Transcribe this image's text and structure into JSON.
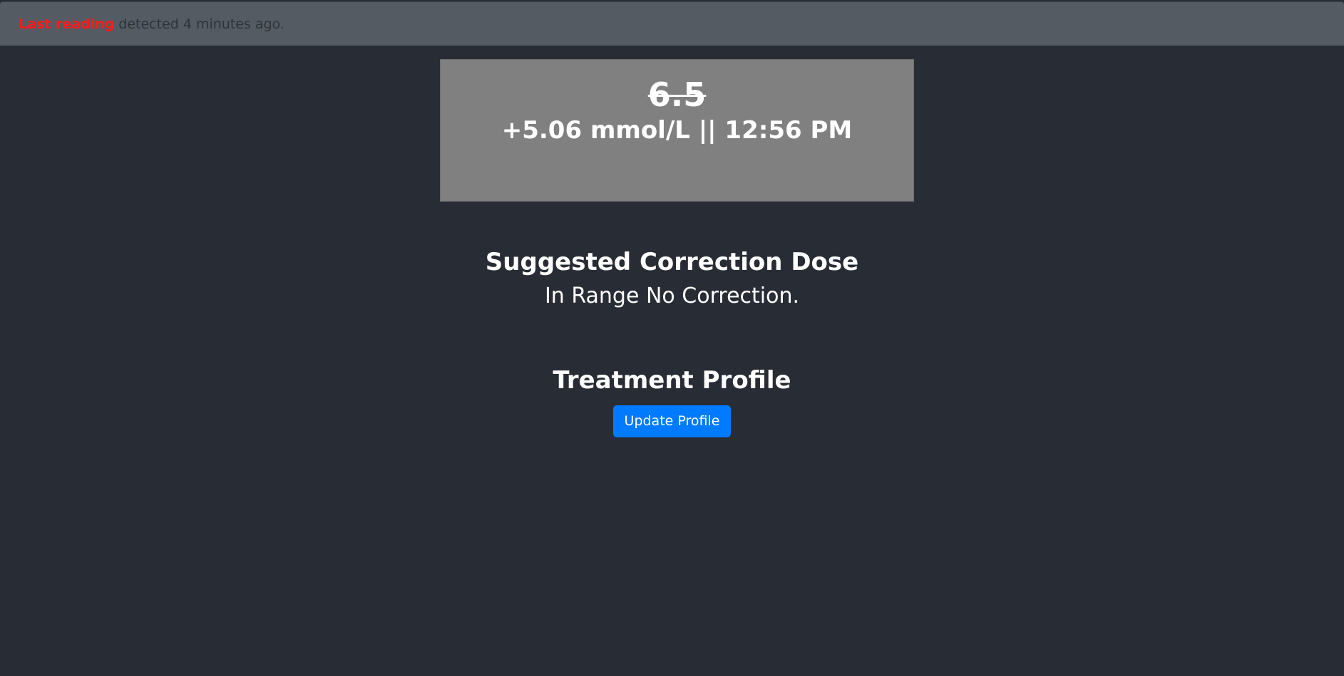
{
  "alert": {
    "strong_text": "Last reading",
    "message": "detected 4 minutes ago."
  },
  "reading": {
    "value": "6.5",
    "detail": "+5.06 mmol/L || 12:56 PM"
  },
  "correction": {
    "title": "Suggested Correction Dose",
    "message": "In Range No Correction."
  },
  "profile": {
    "title": "Treatment Profile",
    "button_label": "Update Profile"
  },
  "colors": {
    "background": "#282c34",
    "alert_bar": "#545b62",
    "alert_text": "#ff1a1a",
    "card": "#808080",
    "button": "#007bff"
  }
}
